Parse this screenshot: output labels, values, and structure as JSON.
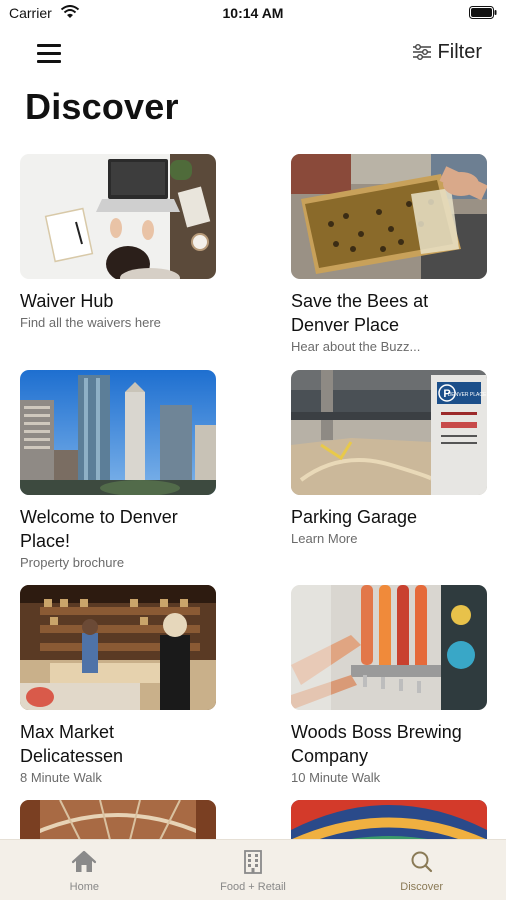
{
  "status_bar": {
    "carrier": "Carrier",
    "time": "10:14 AM"
  },
  "header": {
    "menu_icon": "hamburger-menu-icon",
    "filter_label": "Filter",
    "filter_icon": "sliders-icon"
  },
  "page": {
    "title": "Discover"
  },
  "cards": [
    {
      "title": "Waiver Hub",
      "subtitle": "Find all the waivers here"
    },
    {
      "title": "Save the Bees at Denver Place",
      "subtitle": "Hear about the Buzz..."
    },
    {
      "title": "Welcome to Denver Place!",
      "subtitle": "Property brochure"
    },
    {
      "title": "Parking Garage",
      "subtitle": "Learn More"
    },
    {
      "title": "Max Market Delicatessen",
      "subtitle": "8 Minute Walk"
    },
    {
      "title": "Woods Boss Brewing Company",
      "subtitle": "10 Minute Walk"
    },
    {
      "title": "",
      "subtitle": ""
    },
    {
      "title": "",
      "subtitle": ""
    }
  ],
  "image_text": {
    "parking_sign_p": "P",
    "parking_sign_name": "DENVER PLACE"
  },
  "tabs": [
    {
      "label": "Home",
      "icon": "home-icon",
      "active": false
    },
    {
      "label": "Food + Retail",
      "icon": "building-icon",
      "active": false
    },
    {
      "label": "Discover",
      "icon": "search-icon",
      "active": true
    }
  ],
  "colors": {
    "accent": "#8a7a56",
    "tab_bar_bg": "#f3efe8",
    "inactive_tab": "#888888"
  }
}
